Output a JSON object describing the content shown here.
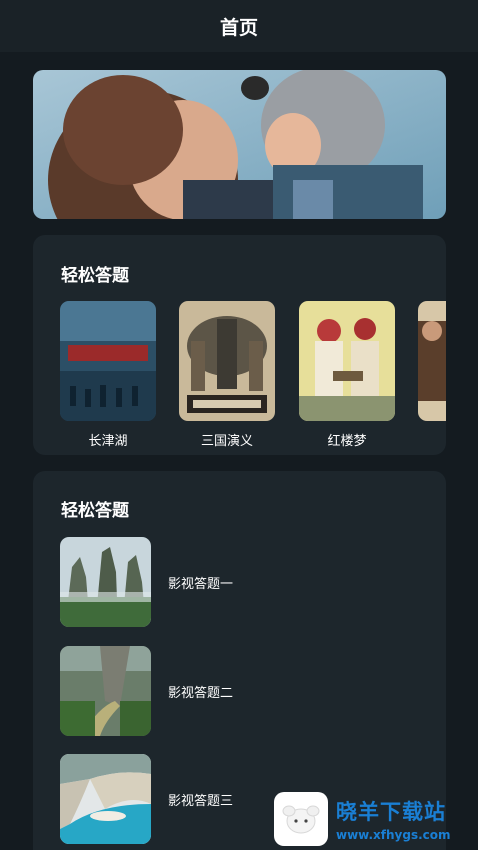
{
  "header": {
    "title": "首页"
  },
  "banner": {
    "image": "mother-and-child-photo"
  },
  "section_posters": {
    "title": "轻松答题",
    "items": [
      {
        "label": "长津湖",
        "image": "changjin-lake-poster"
      },
      {
        "label": "三国演义",
        "image": "three-kingdoms-poster"
      },
      {
        "label": "红楼梦",
        "image": "red-mansions-poster"
      },
      {
        "label": "",
        "image": "partial-poster"
      }
    ]
  },
  "section_quiz": {
    "title": "轻松答题",
    "items": [
      {
        "label": "影视答题一",
        "image": "karst-mountains-photo"
      },
      {
        "label": "影视答题二",
        "image": "cliff-river-photo"
      },
      {
        "label": "影视答题三",
        "image": "beach-cove-photo"
      }
    ]
  },
  "watermark": {
    "name": "晓羊下载站",
    "url": "www.xfhygs.com"
  },
  "colors": {
    "background": "#141b20",
    "card": "#1d262c",
    "topbar": "#1a2227",
    "watermark": "#1a7fd4"
  }
}
